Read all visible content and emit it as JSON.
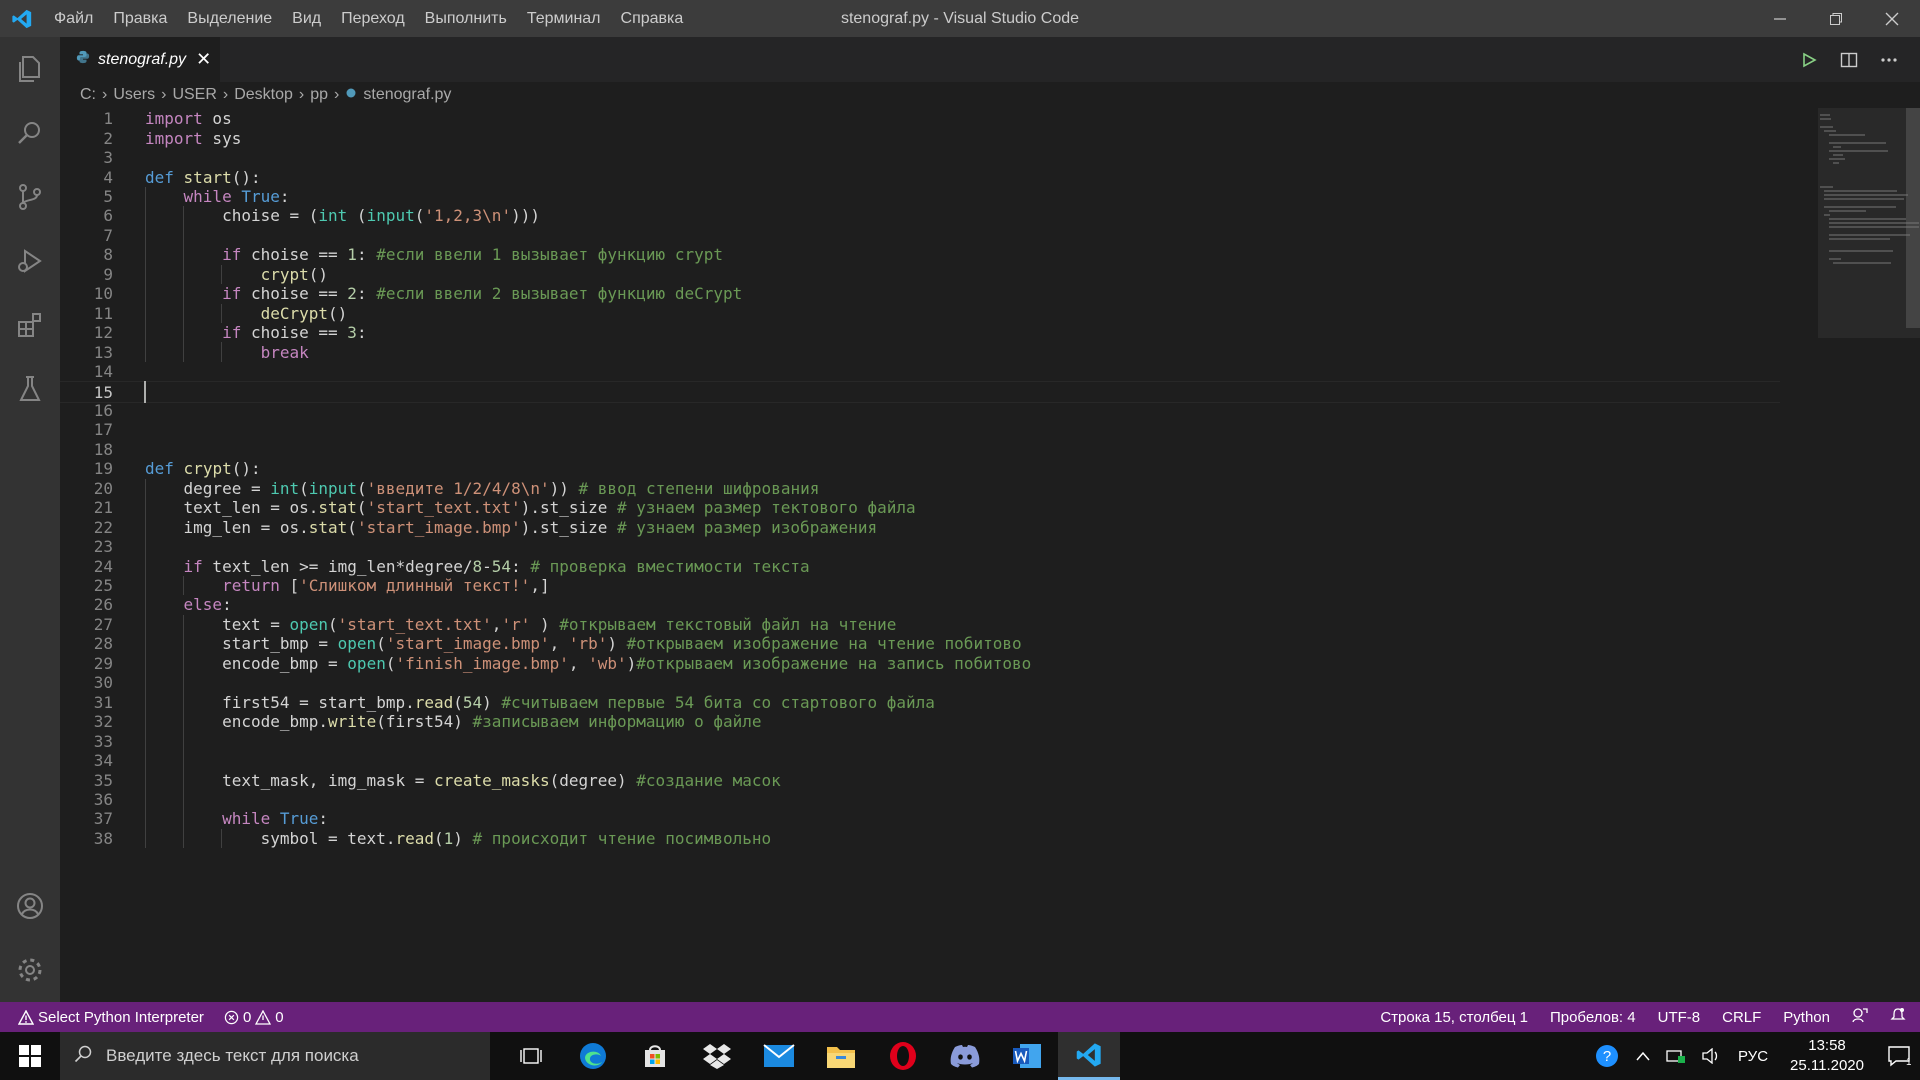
{
  "window": {
    "title": "stenograf.py - Visual Studio Code",
    "menu": [
      "Файл",
      "Правка",
      "Выделение",
      "Вид",
      "Переход",
      "Выполнить",
      "Терминал",
      "Справка"
    ]
  },
  "tab": {
    "name": "stenograf.py",
    "close_glyph": "✕"
  },
  "breadcrumb": [
    "C:",
    "Users",
    "USER",
    "Desktop",
    "pp",
    "stenograf.py"
  ],
  "code": {
    "lines": [
      {
        "n": "1",
        "text": "import os"
      },
      {
        "n": "2",
        "text": "import sys"
      },
      {
        "n": "3",
        "text": ""
      },
      {
        "n": "4",
        "text": "def start():"
      },
      {
        "n": "5",
        "text": "    while True:"
      },
      {
        "n": "6",
        "text": "        choise = (int (input('1,2,3\\n')))"
      },
      {
        "n": "7",
        "text": ""
      },
      {
        "n": "8",
        "text": "        if choise == 1: #если ввели 1 вызывает функцию crypt"
      },
      {
        "n": "9",
        "text": "            crypt()"
      },
      {
        "n": "10",
        "text": "        if choise == 2: #если ввели 2 вызывает функцию deCrypt"
      },
      {
        "n": "11",
        "text": "            deCrypt()"
      },
      {
        "n": "12",
        "text": "        if choise == 3:"
      },
      {
        "n": "13",
        "text": "            break"
      },
      {
        "n": "14",
        "text": ""
      },
      {
        "n": "15",
        "text": ""
      },
      {
        "n": "16",
        "text": ""
      },
      {
        "n": "17",
        "text": ""
      },
      {
        "n": "18",
        "text": ""
      },
      {
        "n": "19",
        "text": "def crypt():"
      },
      {
        "n": "20",
        "text": "    degree = int(input('введите 1/2/4/8\\n')) # ввод степени шифрования"
      },
      {
        "n": "21",
        "text": "    text_len = os.stat('start_text.txt').st_size # узнаем размер тектового файла"
      },
      {
        "n": "22",
        "text": "    img_len = os.stat('start_image.bmp').st_size # узнаем размер изображения"
      },
      {
        "n": "23",
        "text": ""
      },
      {
        "n": "24",
        "text": "    if text_len >= img_len*degree/8-54: # проверка вместимости текста"
      },
      {
        "n": "25",
        "text": "        return ['Слишком длинный текст!',]"
      },
      {
        "n": "26",
        "text": "    else:"
      },
      {
        "n": "27",
        "text": "        text = open('start_text.txt','r' ) #открываем текстовый файл на чтение"
      },
      {
        "n": "28",
        "text": "        start_bmp = open('start_image.bmp', 'rb') #открываем изображение на чтение побитово"
      },
      {
        "n": "29",
        "text": "        encode_bmp = open('finish_image.bmp', 'wb')#открываем изображение на запись побитово"
      },
      {
        "n": "30",
        "text": ""
      },
      {
        "n": "31",
        "text": "        first54 = start_bmp.read(54) #считываем первые 54 бита со стартового файла"
      },
      {
        "n": "32",
        "text": "        encode_bmp.write(first54) #записываем информацию о файле"
      },
      {
        "n": "33",
        "text": ""
      },
      {
        "n": "34",
        "text": ""
      },
      {
        "n": "35",
        "text": "        text_mask, img_mask = create_masks(degree) #создание масок"
      },
      {
        "n": "36",
        "text": ""
      },
      {
        "n": "37",
        "text": "        while True:"
      },
      {
        "n": "38",
        "text": "            symbol = text.read(1) # происходит чтение посимвольно"
      }
    ],
    "current_line": "15"
  },
  "statusbar": {
    "interpreter": "Select Python Interpreter",
    "errors": "0",
    "warnings": "0",
    "position": "Строка 15, столбец 1",
    "spaces": "Пробелов: 4",
    "encoding": "UTF-8",
    "eol": "CRLF",
    "language": "Python"
  },
  "taskbar": {
    "search_placeholder": "Введите здесь текст для поиска",
    "apps": [
      "task-view-icon",
      "edge-icon",
      "store-icon",
      "dropbox-icon",
      "mail-icon",
      "explorer-icon",
      "opera-icon",
      "discord-icon",
      "word-icon",
      "vscode-icon"
    ],
    "lang": "РУС",
    "time": "13:58",
    "date": "25.11.2020",
    "notifications": "1"
  },
  "colors": {
    "titlebar": "#3c3c3c",
    "activitybar": "#333333",
    "editor": "#1e1e1e",
    "statusbar": "#68217a",
    "taskbar": "#101010"
  }
}
